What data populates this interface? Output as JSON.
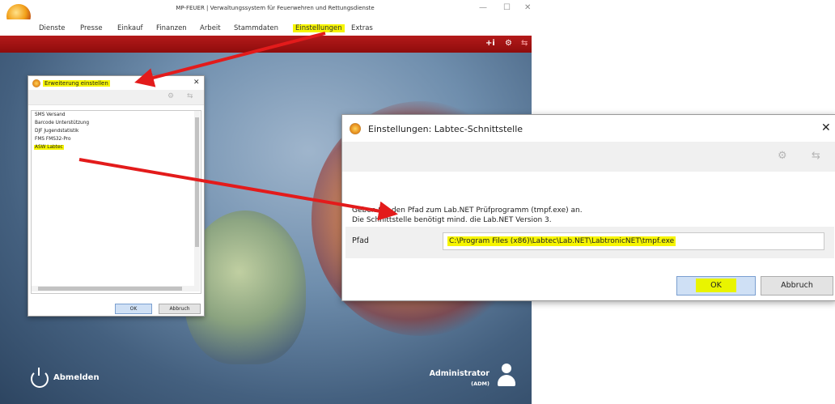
{
  "app": {
    "title": "MP-FEUER | Verwaltungssystem für Feuerwehren und Rettungsdienste",
    "window_controls": {
      "minimize": "—",
      "maximize": "☐",
      "close": "✕"
    },
    "menu": [
      "Dienste",
      "Presse",
      "Einkauf",
      "Finanzen",
      "Arbeit",
      "Stammdaten",
      "Einstellungen",
      "Extras"
    ],
    "highlighted_menu": "Einstellungen",
    "toolbar_icons": [
      {
        "icon": "add-info-icon",
        "glyph": "+i"
      },
      {
        "icon": "settings-gears-icon",
        "glyph": "⚙"
      },
      {
        "icon": "swap-arrows-icon",
        "glyph": "⇆"
      }
    ],
    "logout_label": "Abmelden",
    "user_name": "Administrator",
    "user_code": "(ADM)"
  },
  "extension_dialog": {
    "title": "Erweiterung einstellen",
    "close_glyph": "✕",
    "toolbar_icons": [
      {
        "icon": "settings-gears-icon",
        "glyph": "⚙"
      },
      {
        "icon": "swap-arrows-icon",
        "glyph": "⇆"
      }
    ],
    "items": [
      "SMS Versand",
      "Barcode Unterstützung",
      "DJF Jugendstatistik",
      "FMS FMS32-Pro",
      "ASW Labtec"
    ],
    "selected_item": "ASW Labtec",
    "ok_label": "OK",
    "cancel_label": "Abbruch"
  },
  "labtec_dialog": {
    "title": "Einstellungen: Labtec-Schnittstelle",
    "close_glyph": "✕",
    "toolbar_icons": [
      {
        "icon": "settings-gears-icon",
        "glyph": "⚙"
      },
      {
        "icon": "swap-arrows-icon",
        "glyph": "⇆"
      }
    ],
    "instruction_line1": "Geben Sie den Pfad zum Lab.NET Prüfprogramm (tmpf.exe) an.",
    "instruction_line2": "Die Schnittstelle benötigt mind. die Lab.NET Version 3.",
    "path_label": "Pfad",
    "path_value": "C:\\Program Files (x86)\\Labtec\\Lab.NET\\LabtronicNET\\tmpf.exe",
    "ok_label": "OK",
    "cancel_label": "Abbruch"
  },
  "colors": {
    "highlight": "#f6f500",
    "toolbar_red": "#a31414",
    "annotation_arrow": "#e31b1b",
    "dialog_button_blue": "#cfe0f5"
  }
}
